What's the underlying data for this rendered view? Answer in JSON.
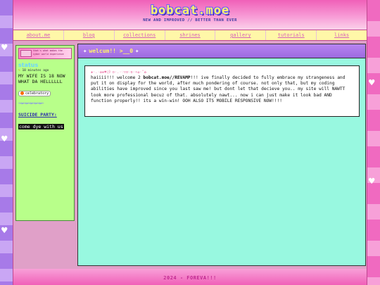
{
  "site": {
    "logo": "bobcat.moe",
    "tagline": "NEW AND IMPROVED // BETTER THAN EVER"
  },
  "nav": {
    "items": [
      {
        "label": "about.me"
      },
      {
        "label": "blog"
      },
      {
        "label": "collections"
      },
      {
        "label": "shrines"
      },
      {
        "label": "gallery"
      },
      {
        "label": "tutorials"
      },
      {
        "label": "links"
      }
    ]
  },
  "sidebar": {
    "banner_text": "that's what makes the cyber world experience",
    "status_heading": "status",
    "status_time": "18 minutes ago",
    "status_text": "MY WIFE IS 18 NOW WHAT DA HELLLLLL",
    "status_badge": "celebratory",
    "party_label": "SUICIDE PARTY:",
    "party_value": "come dye with us"
  },
  "main": {
    "title": "welcum!! >__0",
    "post_decoration": "❀·.·✿❁♥♫》ɒ·.·♡▽ɒ♡ɒ·•❂·˚✿",
    "post_intro": "haiiii!!! welcome 2 ",
    "post_highlight": "bobcat.moe//REVAMP",
    "post_rest": "!!! ive finally decided to fully embrace my strangeness and put it on display for the world, after much pondering of course. not only that, but my coding abilities have improved since you last saw me! but dont let that decieve you.. my site will NAWTT look more professional becuz of that. absolutely nawt... now i can just make it look bad AND function properly!! its a win-win! OOH ALSO ITS MOBILE RESPONSIVE NOW!!!!"
  },
  "footer": {
    "text": "2024 - FOREVA!!!"
  },
  "colors": {
    "accent_pink": "#f060b8",
    "nav_bg": "#fff7a8",
    "sidebar_bg": "#b8ff8a",
    "main_bg": "#98f8e0",
    "title_bar": "#b884f0",
    "logo_yellow": "#fff36a"
  }
}
